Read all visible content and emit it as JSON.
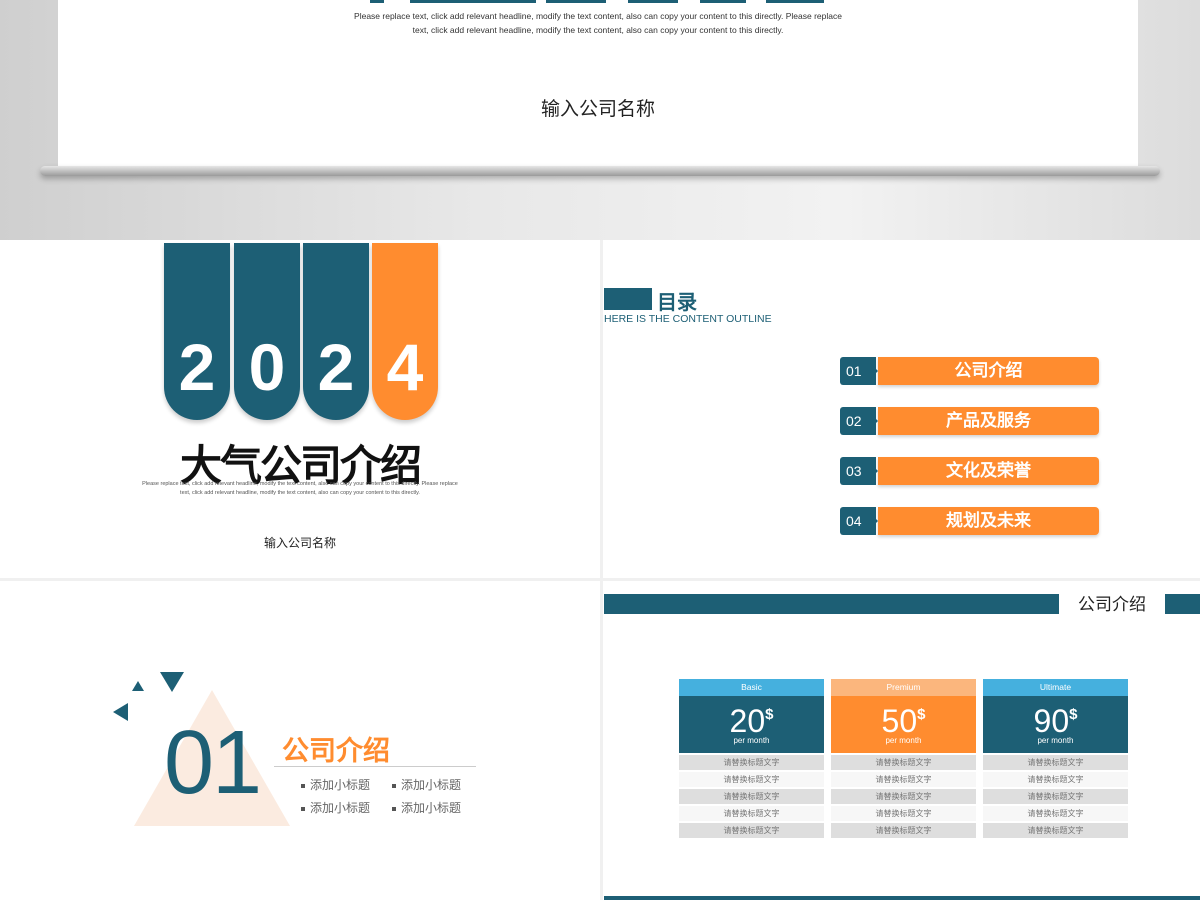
{
  "colors": {
    "teal": "#1d5f75",
    "orange": "#ff8c2f",
    "sky": "#45b0de",
    "peach": "#fbb67d"
  },
  "hero": {
    "desc_lines": [
      "Please replace text, click add relevant headline, modify the text content, also can copy your content to this directly. Please replace",
      "text, click add relevant headline, modify the text content, also can copy your content to this directly."
    ],
    "company": "输入公司名称"
  },
  "slide1": {
    "digits": [
      "2",
      "0",
      "2",
      "4"
    ],
    "title": "大气公司介绍",
    "desc_lines": [
      "Please replace text, click add relevant headline, modify the text content, also can copy your content to this directly. Please replace",
      "text, click add relevant headline, modify the text content, also can copy your content to this directly."
    ],
    "company": "输入公司名称"
  },
  "slide2": {
    "heading": "目录",
    "subheading": "HERE IS THE CONTENT OUTLINE",
    "items": [
      {
        "num": "01",
        "label": "公司介绍"
      },
      {
        "num": "02",
        "label": "产品及服务"
      },
      {
        "num": "03",
        "label": "文化及荣誉"
      },
      {
        "num": "04",
        "label": "规划及未来"
      }
    ]
  },
  "slide3": {
    "number": "01",
    "title": "公司介绍",
    "subtitles": [
      "添加小标题",
      "添加小标题",
      "添加小标题",
      "添加小标题"
    ]
  },
  "slide4": {
    "title": "公司介绍",
    "plans": [
      {
        "tier": "Basic",
        "price": "20",
        "currency": "$",
        "period": "per month",
        "rows": [
          "请替换标题文字",
          "请替换标题文字",
          "请替换标题文字",
          "请替换标题文字",
          "请替换标题文字"
        ]
      },
      {
        "tier": "Premium",
        "price": "50",
        "currency": "$",
        "period": "per month",
        "rows": [
          "请替换标题文字",
          "请替换标题文字",
          "请替换标题文字",
          "请替换标题文字",
          "请替换标题文字"
        ]
      },
      {
        "tier": "Ultimate",
        "price": "90",
        "currency": "$",
        "period": "per month",
        "rows": [
          "请替换标题文字",
          "请替换标题文字",
          "请替换标题文字",
          "请替换标题文字",
          "请替换标题文字"
        ]
      }
    ]
  }
}
